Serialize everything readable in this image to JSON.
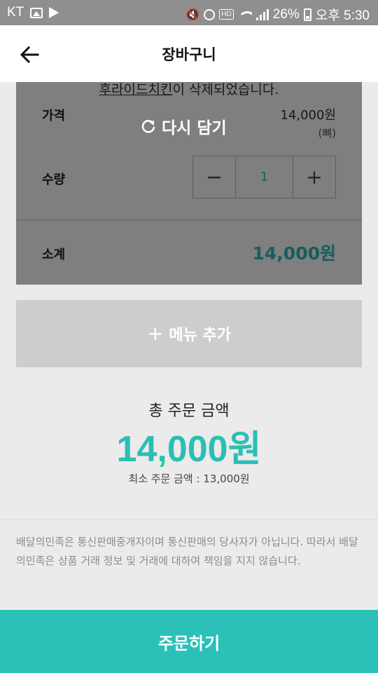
{
  "status_bar": {
    "carrier": "KT",
    "battery": "26%",
    "time": "오후 5:30",
    "hd_badge": "HD",
    "icons": [
      "gallery-icon",
      "play-store-icon",
      "mute-icon",
      "alarm-icon",
      "hd-voice-icon",
      "wifi-icon",
      "signal-icon",
      "battery-icon"
    ]
  },
  "header": {
    "title": "장바구니",
    "back_icon": "arrow-left-icon"
  },
  "cart_item": {
    "name": "후라이드치킨",
    "deleted_suffix": "이 삭제되었습니다.",
    "restore_label": "다시 담기",
    "price_label": "가격",
    "price": "14,000원",
    "price_option": "(뼈)",
    "qty_label": "수량",
    "qty_minus": "−",
    "qty_value": "1",
    "qty_plus": "+",
    "subtotal_label": "소계",
    "subtotal": "14,000원"
  },
  "add_menu": {
    "label": "메뉴 추가",
    "icon": "+"
  },
  "summary": {
    "total_label": "총 주문 금액",
    "total": "14,000원",
    "min_order": "최소 주문 금액 : 13,000원"
  },
  "disclaimer": "배달의민족은 통신판매중개자이며 통신판매의 당사자가 아닙니다. 따라서 배달의민족은 상품 거래 정보 및 거래에 대하여 책임을 지지 않습니다.",
  "order_button": "주문하기",
  "colors": {
    "accent": "#2bc1b9",
    "overlay": "rgba(0,0,0,0.5)",
    "add_menu_bg": "#cdcdcd",
    "background": "#ebebeb"
  }
}
